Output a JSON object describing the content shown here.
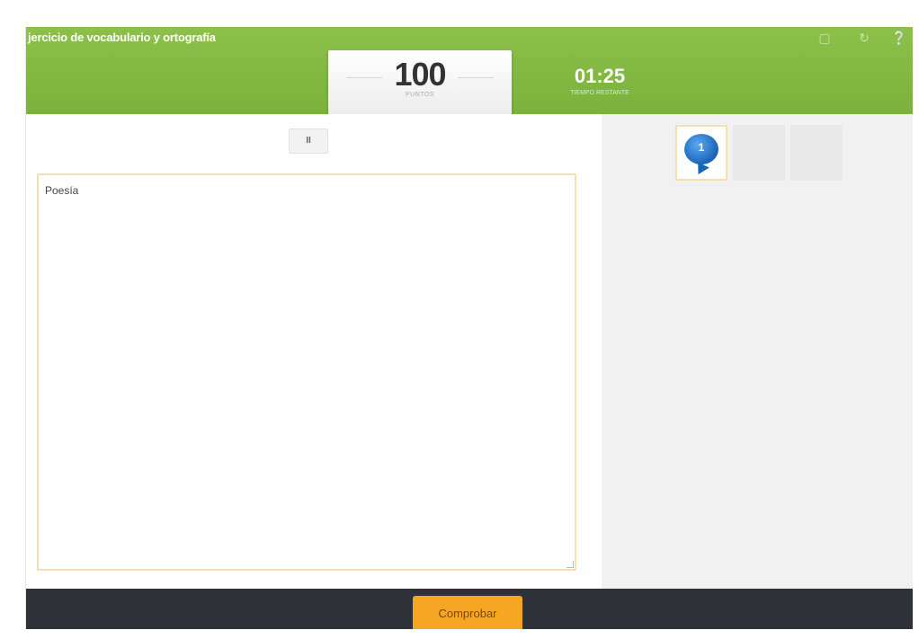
{
  "header": {
    "title": "jercicio de vocabulario y ortografía",
    "icons": [
      "fullscreen-icon",
      "refresh-icon",
      "help-icon"
    ],
    "score": {
      "value": "100",
      "label": "PUNTOS"
    },
    "timer": {
      "value": "01:25",
      "label": "TIEMPO RESTANTE"
    },
    "accent_color": "#7cb342"
  },
  "controls": {
    "pause_label": "II"
  },
  "answer": {
    "text": "Poesía"
  },
  "hints": {
    "active_number": "1",
    "slots": 3
  },
  "footer": {
    "check_label": "Comprobar",
    "button_color": "#f6a623"
  }
}
